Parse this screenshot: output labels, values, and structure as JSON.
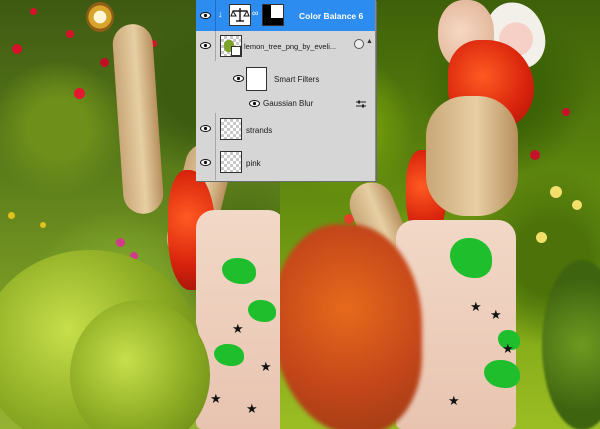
{
  "layers_panel": {
    "layers": [
      {
        "name": "Color Balance 6",
        "selected": true,
        "visible": true,
        "kind": "adjustment"
      },
      {
        "name": "lemon_tree_png_by_eveli...",
        "selected": false,
        "visible": true,
        "kind": "smart-object"
      },
      {
        "name": "Smart Filters",
        "selected": false,
        "visible": true,
        "kind": "filter-group"
      },
      {
        "name": "Gaussian Blur",
        "selected": false,
        "visible": true,
        "kind": "filter"
      },
      {
        "name": "strands",
        "selected": false,
        "visible": true,
        "kind": "pixel"
      },
      {
        "name": "pink",
        "selected": false,
        "visible": true,
        "kind": "pixel"
      }
    ]
  },
  "colors": {
    "selection": "#2d8cf0",
    "panel_bg": "#d6d6d6",
    "hair": "#e0300f",
    "dress_pattern": "#1fbe2c"
  },
  "icons": {
    "visibility": "eye-icon",
    "adjustment": "balance-scale-icon",
    "link": "chain-link-icon",
    "smart_object": "smart-object-icon",
    "filter_options": "filter-options-icon"
  }
}
